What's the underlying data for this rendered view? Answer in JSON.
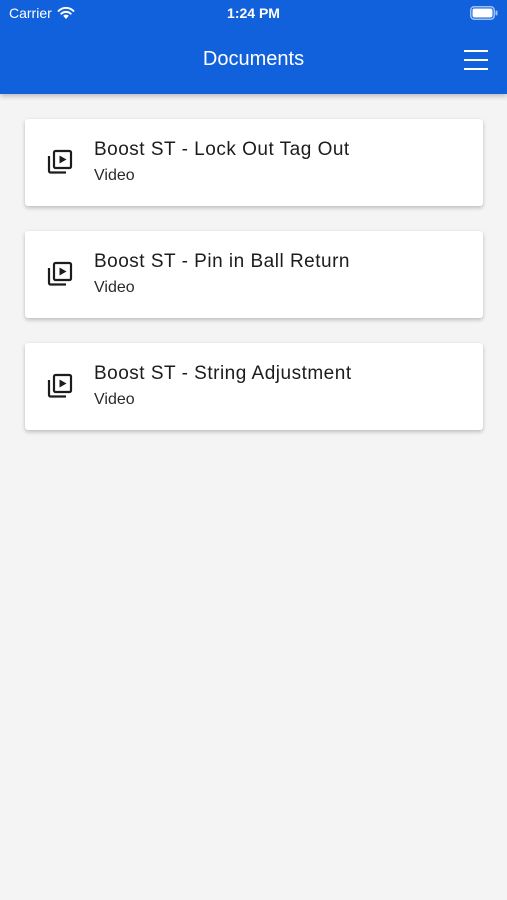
{
  "status_bar": {
    "carrier": "Carrier",
    "time": "1:24 PM"
  },
  "nav": {
    "title": "Documents",
    "menu_icon": "hamburger-menu-icon"
  },
  "colors": {
    "accent": "#1261dc",
    "background": "#f4f4f4",
    "card": "#ffffff"
  },
  "documents": [
    {
      "title": "Boost ST - Lock Out Tag Out",
      "type": "Video",
      "icon": "video-library-icon"
    },
    {
      "title": "Boost ST - Pin in Ball Return",
      "type": "Video",
      "icon": "video-library-icon"
    },
    {
      "title": "Boost ST - String Adjustment",
      "type": "Video",
      "icon": "video-library-icon"
    }
  ]
}
